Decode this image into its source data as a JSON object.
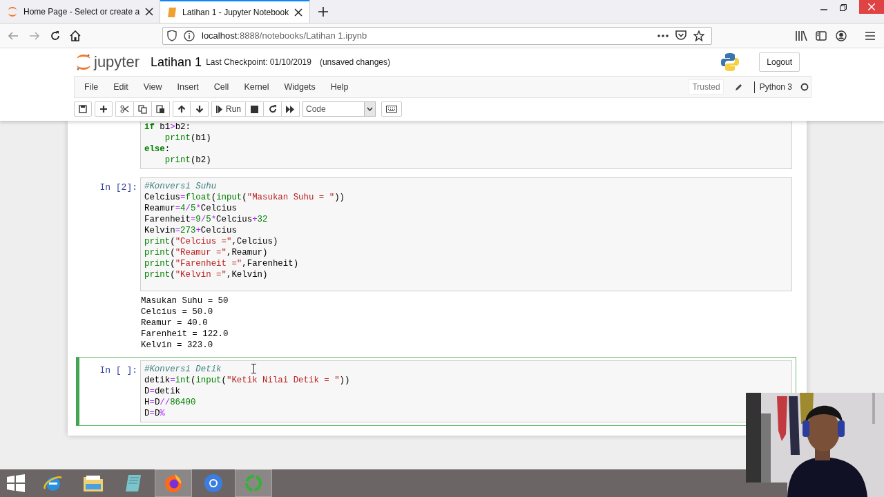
{
  "browser": {
    "tabs": [
      {
        "title": "Home Page - Select or create a",
        "selected": false
      },
      {
        "title": "Latihan 1 - Jupyter Notebook",
        "selected": true
      }
    ],
    "url": {
      "host": "localhost",
      "path": ":8888/notebooks/Latihan 1.ipynb"
    }
  },
  "header": {
    "logo": "jupyter",
    "notebook_name": "Latihan 1",
    "checkpoint": "Last Checkpoint: 01/10/2019",
    "status": "(unsaved changes)",
    "logout": "Logout"
  },
  "menu": [
    "File",
    "Edit",
    "View",
    "Insert",
    "Cell",
    "Kernel",
    "Widgets",
    "Help"
  ],
  "toolbar": {
    "run": "Run",
    "cell_type": "Code"
  },
  "kernel": {
    "trusted": "Trusted",
    "name": "Python 3",
    "busy": false
  },
  "cells": [
    {
      "selected": false,
      "input": [
        [
          {
            "kind": "keyword",
            "text": "if"
          },
          {
            "kind": "name",
            "text": " b1"
          },
          {
            "kind": "operator",
            "text": ">"
          },
          {
            "kind": "name",
            "text": "b2:"
          }
        ],
        [
          {
            "kind": "builtin",
            "text": "    print"
          },
          {
            "kind": "name",
            "text": "(b1)"
          }
        ],
        [
          {
            "kind": "keyword",
            "text": "else"
          },
          {
            "kind": "name",
            "text": ":"
          }
        ],
        [
          {
            "kind": "builtin",
            "text": "    print"
          },
          {
            "kind": "name",
            "text": "(b2)"
          }
        ]
      ]
    },
    {
      "prompt": "In [2]:",
      "selected": false,
      "input": [
        [
          {
            "kind": "comment",
            "text": "#Konversi Suhu"
          }
        ],
        [
          {
            "kind": "name",
            "text": "Celcius"
          },
          {
            "kind": "operator",
            "text": "="
          },
          {
            "kind": "builtin",
            "text": "float"
          },
          {
            "kind": "name",
            "text": "("
          },
          {
            "kind": "builtin",
            "text": "input"
          },
          {
            "kind": "name",
            "text": "("
          },
          {
            "kind": "string",
            "text": "\"Masukan Suhu = \""
          },
          {
            "kind": "name",
            "text": "))"
          }
        ],
        [
          {
            "kind": "name",
            "text": "Reamur"
          },
          {
            "kind": "operator",
            "text": "="
          },
          {
            "kind": "number",
            "text": "4"
          },
          {
            "kind": "operator",
            "text": "/"
          },
          {
            "kind": "number",
            "text": "5"
          },
          {
            "kind": "operator",
            "text": "*"
          },
          {
            "kind": "name",
            "text": "Celcius"
          }
        ],
        [
          {
            "kind": "name",
            "text": "Farenheit"
          },
          {
            "kind": "operator",
            "text": "="
          },
          {
            "kind": "number",
            "text": "9"
          },
          {
            "kind": "operator",
            "text": "/"
          },
          {
            "kind": "number",
            "text": "5"
          },
          {
            "kind": "operator",
            "text": "*"
          },
          {
            "kind": "name",
            "text": "Celcius"
          },
          {
            "kind": "operator",
            "text": "+"
          },
          {
            "kind": "number",
            "text": "32"
          }
        ],
        [
          {
            "kind": "name",
            "text": "Kelvin"
          },
          {
            "kind": "operator",
            "text": "="
          },
          {
            "kind": "number",
            "text": "273"
          },
          {
            "kind": "operator",
            "text": "+"
          },
          {
            "kind": "name",
            "text": "Celcius"
          }
        ],
        [
          {
            "kind": "builtin",
            "text": "print"
          },
          {
            "kind": "name",
            "text": "("
          },
          {
            "kind": "string",
            "text": "\"Celcius =\""
          },
          {
            "kind": "name",
            "text": ",Celcius)"
          }
        ],
        [
          {
            "kind": "builtin",
            "text": "print"
          },
          {
            "kind": "name",
            "text": "("
          },
          {
            "kind": "string",
            "text": "\"Reamur =\""
          },
          {
            "kind": "name",
            "text": ",Reamur)"
          }
        ],
        [
          {
            "kind": "builtin",
            "text": "print"
          },
          {
            "kind": "name",
            "text": "("
          },
          {
            "kind": "string",
            "text": "\"Farenheit =\""
          },
          {
            "kind": "name",
            "text": ",Farenheit)"
          }
        ],
        [
          {
            "kind": "builtin",
            "text": "print"
          },
          {
            "kind": "name",
            "text": "("
          },
          {
            "kind": "string",
            "text": "\"Kelvin =\""
          },
          {
            "kind": "name",
            "text": ",Kelvin)"
          }
        ]
      ],
      "output": [
        "Masukan Suhu = 50",
        "Celcius = 50.0",
        "Reamur = 40.0",
        "Farenheit = 122.0",
        "Kelvin = 323.0"
      ]
    },
    {
      "prompt": "In [ ]:",
      "selected": true,
      "input": [
        [
          {
            "kind": "comment",
            "text": "#Konversi Detik"
          }
        ],
        [
          {
            "kind": "name",
            "text": "detik"
          },
          {
            "kind": "operator",
            "text": "="
          },
          {
            "kind": "builtin",
            "text": "int"
          },
          {
            "kind": "name",
            "text": "("
          },
          {
            "kind": "builtin",
            "text": "input"
          },
          {
            "kind": "name",
            "text": "("
          },
          {
            "kind": "string",
            "text": "\"Ketik Nilai Detik = \""
          },
          {
            "kind": "name",
            "text": "))"
          }
        ],
        [
          {
            "kind": "name",
            "text": "D"
          },
          {
            "kind": "operator",
            "text": "="
          },
          {
            "kind": "name",
            "text": "detik"
          }
        ],
        [
          {
            "kind": "name",
            "text": "H"
          },
          {
            "kind": "operator",
            "text": "="
          },
          {
            "kind": "name",
            "text": "D"
          },
          {
            "kind": "operator",
            "text": "//"
          },
          {
            "kind": "number",
            "text": "86400"
          }
        ],
        [
          {
            "kind": "name",
            "text": "D"
          },
          {
            "kind": "operator",
            "text": "="
          },
          {
            "kind": "name",
            "text": "D"
          },
          {
            "kind": "operator",
            "text": "%"
          }
        ]
      ]
    }
  ],
  "taskbar": [
    {
      "kind": "start",
      "active": false
    },
    {
      "kind": "ie",
      "active": false
    },
    {
      "kind": "folder",
      "active": false
    },
    {
      "kind": "notepad",
      "active": false
    },
    {
      "kind": "firefox",
      "active": true
    },
    {
      "kind": "chrome",
      "active": false
    },
    {
      "kind": "ring",
      "active": true
    }
  ],
  "webcam": {
    "kind": "picture"
  }
}
